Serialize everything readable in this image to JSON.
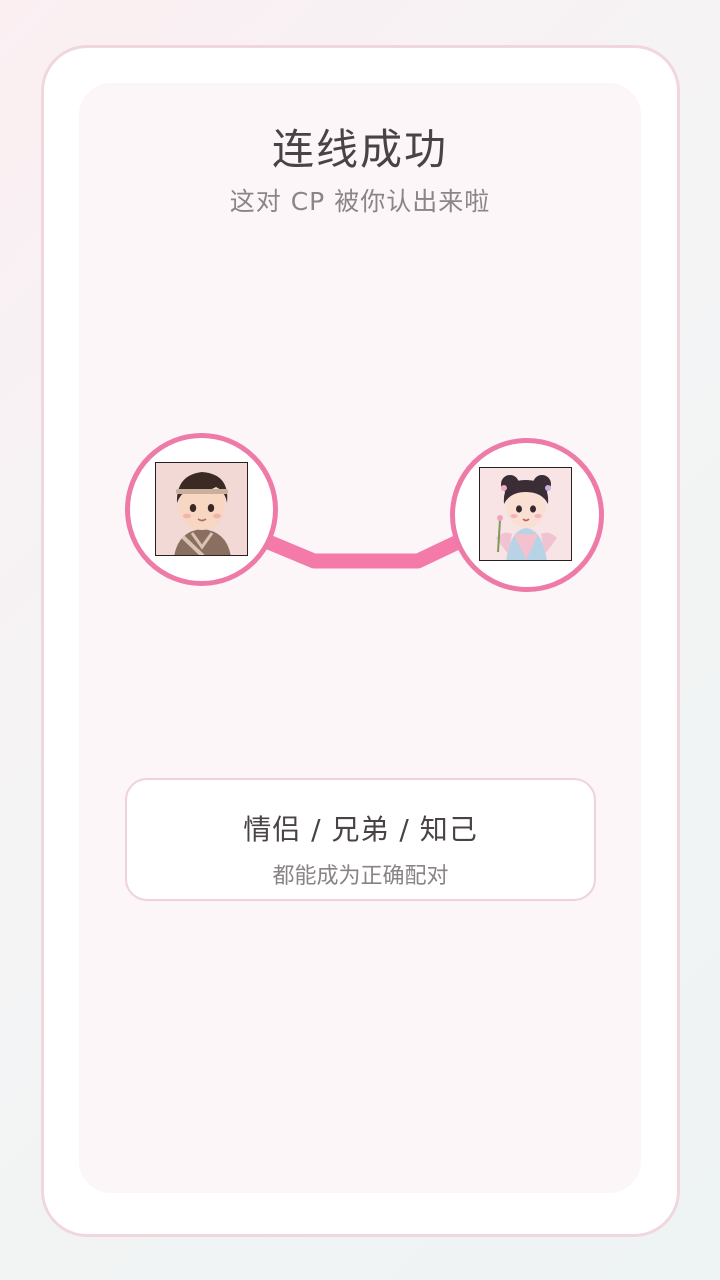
{
  "header": {
    "title": "连线成功",
    "subtitle": "这对 CP 被你认出来啦"
  },
  "pair": {
    "left_avatar": "chibi-boy-avatar",
    "right_avatar": "chibi-girl-avatar",
    "link_color": "#f47aa9",
    "ring_color": "#ee7aa8"
  },
  "note": {
    "main": "情侣 / 兄弟 / 知己",
    "sub": "都能成为正确配对"
  },
  "colors": {
    "frame_border": "#f0d7de",
    "panel_bg": "#fcf6f8",
    "text_dark": "#4a4345",
    "text_muted": "#8c8587"
  }
}
